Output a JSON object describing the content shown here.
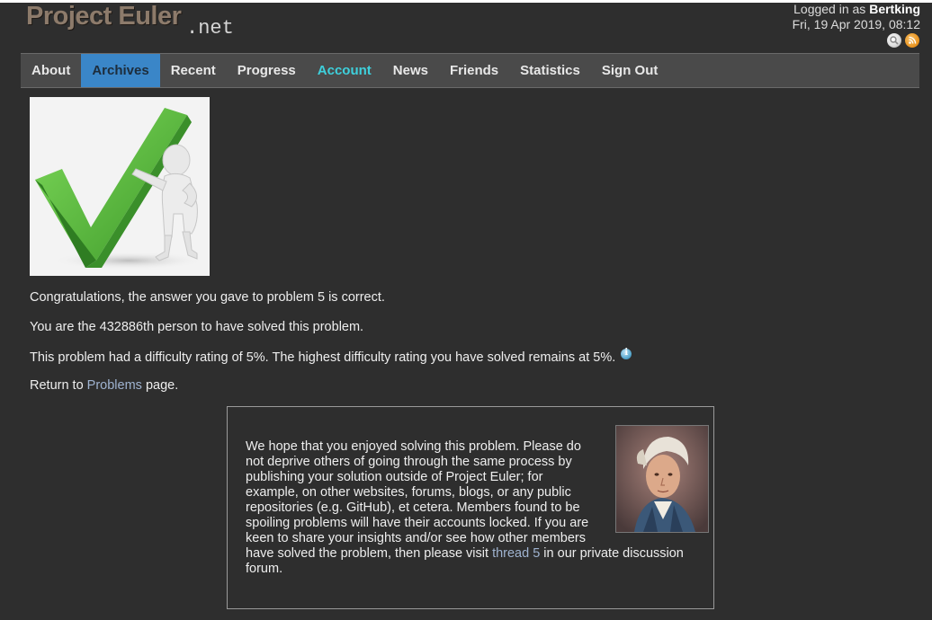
{
  "site": {
    "logo_main": "Project Euler",
    "logo_suffix": ".net"
  },
  "login": {
    "prefix": "Logged in as ",
    "username": "Bertking",
    "datetime": "Fri, 19 Apr 2019, 08:12"
  },
  "nav": {
    "items": [
      {
        "label": "About",
        "state": "normal"
      },
      {
        "label": "Archives",
        "state": "active"
      },
      {
        "label": "Recent",
        "state": "normal"
      },
      {
        "label": "Progress",
        "state": "normal"
      },
      {
        "label": "Account",
        "state": "highlight"
      },
      {
        "label": "News",
        "state": "normal"
      },
      {
        "label": "Friends",
        "state": "normal"
      },
      {
        "label": "Statistics",
        "state": "normal"
      },
      {
        "label": "Sign Out",
        "state": "normal"
      }
    ]
  },
  "result": {
    "congrats": "Congratulations, the answer you gave to problem 5 is correct.",
    "solver_rank": "You are the 432886th person to have solved this problem.",
    "difficulty": "This problem had a difficulty rating of 5%. The highest difficulty rating you have solved remains at 5%.",
    "return_prefix": "Return to ",
    "return_link": "Problems",
    "return_suffix": " page."
  },
  "message": {
    "text_before_link": "We hope that you enjoyed solving this problem. Please do not deprive others of going through the same process by publishing your solution outside of Project Euler; for example, on other websites, forums, blogs, or any public repositories (e.g. GitHub), et cetera. Members found to be spoiling problems will have their accounts locked. If you are keen to share your insights and/or see how other members have solved the problem, then please visit ",
    "link_text": "thread 5",
    "text_after_link": " in our private discussion forum."
  },
  "icons": {
    "search": "search-icon",
    "rss": "rss-icon",
    "info": "info-icon"
  },
  "colors": {
    "background": "#2e2e2e",
    "nav_active": "#3a86c8",
    "nav_highlight": "#3ed0dc",
    "link": "#9fb3d0",
    "check_green": "#5cc23c"
  }
}
